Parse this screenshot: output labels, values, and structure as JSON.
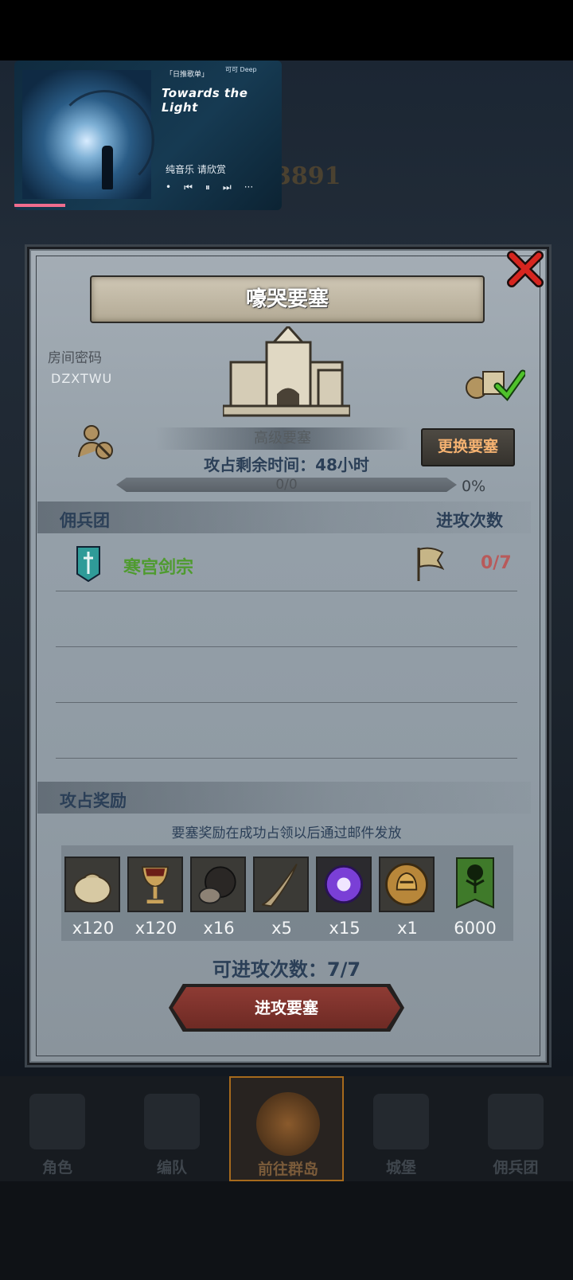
{
  "background": {
    "number_text": "3891"
  },
  "music": {
    "tag": "「日推歌单」",
    "brand": "可可 Deep",
    "title": "Towards the Light",
    "subtitle": "纯音乐 请欣赏",
    "controls": [
      "•",
      "⏮",
      "⏸",
      "⏭",
      "···"
    ],
    "progress": 0.19
  },
  "fortress": {
    "title": "嚎哭要塞",
    "room_label": "房间密码",
    "room_code": "DZXTWU",
    "level_text": "高级要塞",
    "change_button": "更换要塞",
    "time_left": "攻占剩余时间：48小时",
    "progress_text": "0/0",
    "progress_percent": "0%"
  },
  "mercenary": {
    "header_left": "佣兵团",
    "header_right": "进攻次数",
    "rows": [
      {
        "name": "寒宫剑宗",
        "count": "0/7"
      }
    ]
  },
  "rewards": {
    "header": "攻占奖励",
    "note": "要塞奖励在成功占领以后通过邮件发放",
    "items": [
      {
        "icon": "coin-sack-icon",
        "qty": "x120"
      },
      {
        "icon": "goblet-icon",
        "qty": "x120"
      },
      {
        "icon": "truffle-icon",
        "qty": "x16"
      },
      {
        "icon": "horn-icon",
        "qty": "x5"
      },
      {
        "icon": "purple-crystal-icon",
        "qty": "x15"
      },
      {
        "icon": "helmet-medal-icon",
        "qty": "x1"
      },
      {
        "icon": "tree-banner-icon",
        "qty": "6000"
      }
    ],
    "available": "可进攻次数：7/7",
    "attack_button": "进攻要塞"
  },
  "nav": {
    "items": [
      {
        "label": "角色"
      },
      {
        "label": "编队"
      },
      {
        "label": "前往群岛"
      },
      {
        "label": "城堡"
      },
      {
        "label": "佣兵团"
      }
    ]
  },
  "colors": {
    "accent_green": "#4f9b2f",
    "accent_red": "#b85a5a",
    "button_orange": "#f5b271",
    "title_blue": "#2b3f57"
  }
}
